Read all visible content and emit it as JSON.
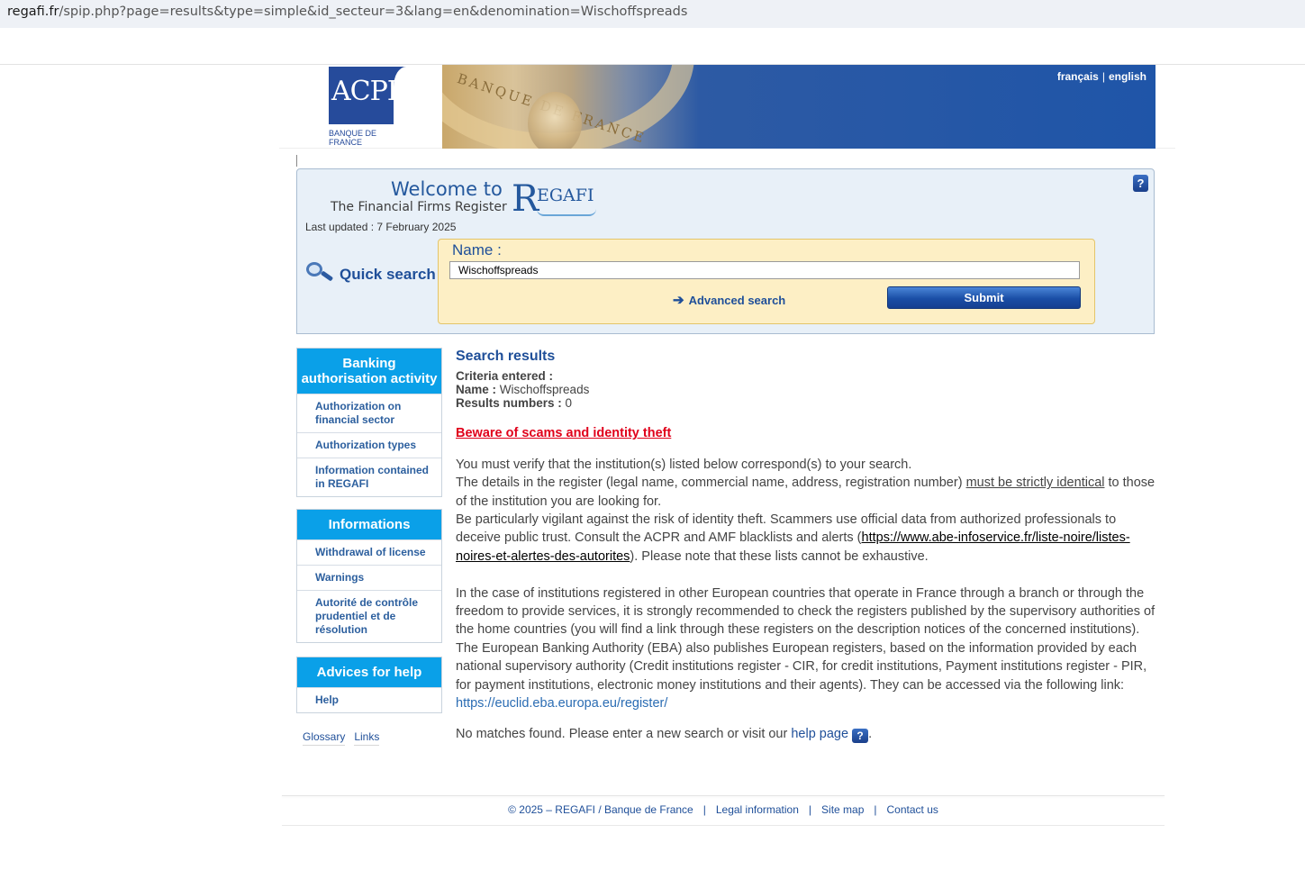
{
  "browser": {
    "url_host": "regafi.fr",
    "url_rest": "/spip.php?page=results&type=simple&id_secteur=3&lang=en&denomination=Wischoffspreads"
  },
  "header": {
    "logo_text": "ACPR",
    "logo_sub": "BANQUE DE FRANCE",
    "banner_text": "BANQUE DE FRANCE",
    "lang_fr": "français",
    "lang_sep": "|",
    "lang_en": "english"
  },
  "search": {
    "welcome": "Welcome to",
    "subtitle": "The Financial Firms Register",
    "regafi_r": "R",
    "regafi_rest": "EGAFI",
    "last_updated": "Last updated : 7 February 2025",
    "help_icon": "?",
    "quick_search": "Quick search",
    "name_label": "Name :",
    "name_value": "Wischoffspreads",
    "advanced_arrow": "➔",
    "advanced_search": "Advanced search",
    "submit_label": "Submit"
  },
  "sidebar": {
    "banking": {
      "title": "Banking authorisation activity",
      "items": [
        "Authorization on financial sector",
        "Authorization types",
        "Information contained in REGAFI"
      ]
    },
    "informations": {
      "title": "Informations",
      "items": [
        "Withdrawal of license",
        "Warnings",
        "Autorité de contrôle prudentiel et de résolution"
      ]
    },
    "help": {
      "title": "Advices for help",
      "items": [
        "Help"
      ]
    },
    "bottom_links": [
      "Glossary",
      "Links"
    ]
  },
  "results": {
    "title": "Search results",
    "criteria_label": "Criteria entered :",
    "name_label": "Name :",
    "name_value": "Wischoffspreads",
    "count_label": "Results numbers :",
    "count_value": "0",
    "scam_warning": "Beware of scams and identity theft",
    "p1": "You must verify that the institution(s) listed below correspond(s) to your search.",
    "p2_a": "The details in the register (legal name, commercial name, address, registration number) ",
    "p2_u": "must be strictly identical",
    "p2_b": " to those of the institution you are looking for.",
    "p3_a": "Be particularly vigilant against the risk of identity theft. Scammers use official data from authorized professionals to deceive public trust. Consult the ACPR and AMF blacklists and alerts (",
    "p3_link": "https://www.abe-infoservice.fr/liste-noire/listes-noires-et-alertes-des-autorites",
    "p3_b": "). Please note that these lists cannot be exhaustive.",
    "p4": "In the case of institutions registered in other European countries that operate in France through a branch or through the freedom to provide services, it is strongly recommended to check the registers published by the supervisory authorities of the home countries (you will find a link through these registers on the description notices of the concerned institutions).",
    "p5": "The European Banking Authority (EBA) also publishes European registers, based on the information provided by each national supervisory authority (Credit institutions register - CIR, for credit institutions, Payment institutions register - PIR, for payment institutions, electronic money institutions and their agents). They can be accessed via the following link:",
    "eba_link": "https://euclid.eba.europa.eu/register/",
    "no_match_a": "No matches found. Please enter a new search or visit our ",
    "help_page": "help page",
    "help_icon": "?",
    "no_match_b": "."
  },
  "footer": {
    "copyright": "© 2025 – REGAFI / Banque de France",
    "legal": "Legal information",
    "sitemap": "Site map",
    "contact": "Contact us",
    "sep": "|"
  }
}
